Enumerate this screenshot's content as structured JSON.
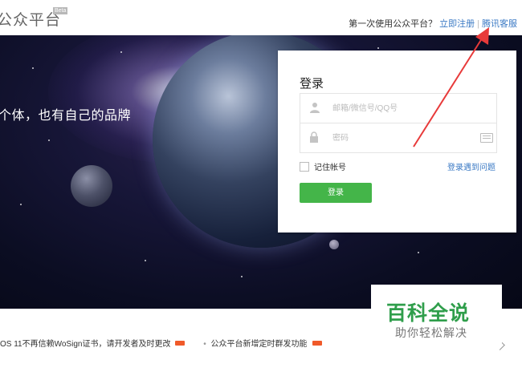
{
  "header": {
    "logo_text": "公众平台",
    "beta_label": "Beta",
    "prompt_text": "第一次使用公众平台？",
    "register_link": "立即注册",
    "separator": "|",
    "support_link": "腾讯客服"
  },
  "banner": {
    "slogan": "个体，也有自己的品牌"
  },
  "login": {
    "title": "登录",
    "account_placeholder": "邮箱/微信号/QQ号",
    "password_placeholder": "密码",
    "remember_label": "记住帐号",
    "problem_link": "登录遇到问题",
    "submit_label": "登录"
  },
  "notices": [
    {
      "text": "OS 11不再信赖WoSign证书，请开发者及时更改"
    },
    {
      "text": "公众平台新增定时群发功能"
    }
  ],
  "watermark": {
    "main": "百科全说",
    "sub": "助你轻松解决"
  },
  "colors": {
    "accent_green": "#44b549",
    "link_blue": "#3a79c4",
    "annotation_red": "#e83a3a",
    "watermark_green": "#2f9e4b"
  }
}
